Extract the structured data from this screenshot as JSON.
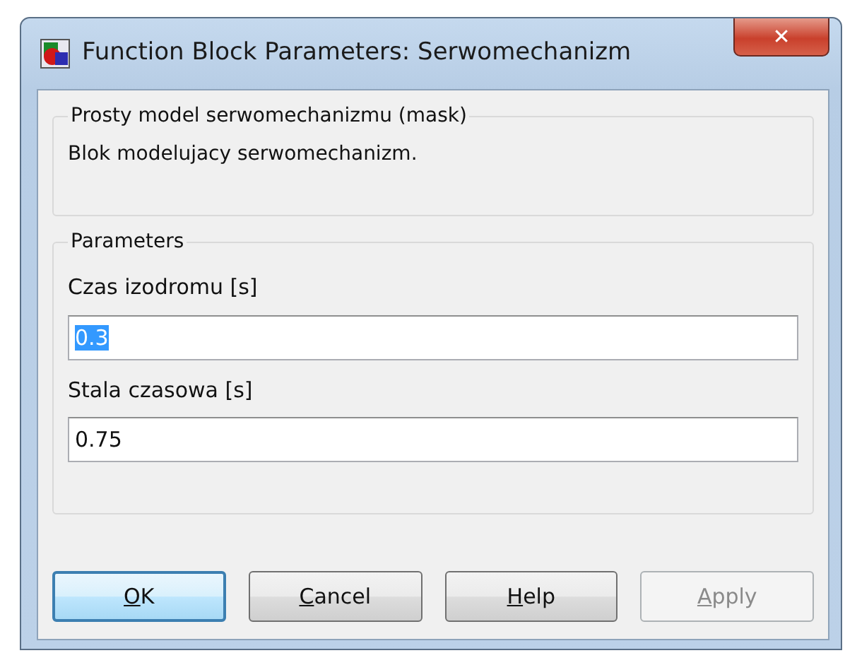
{
  "window": {
    "title": "Function Block Parameters: Serwomechanizm",
    "close": "✕"
  },
  "description_group": {
    "title": "Prosty model serwomechanizmu (mask)",
    "text": "Blok modelujacy serwomechanizm."
  },
  "parameters_group": {
    "title": "Parameters",
    "fields": [
      {
        "label": "Czas izodromu [s]",
        "value": "0.3",
        "text_selected": true
      },
      {
        "label": "Stala czasowa [s]",
        "value": "0.75",
        "text_selected": false
      }
    ]
  },
  "buttons": [
    {
      "label": "OK",
      "first_letter_underlined": true,
      "default": true,
      "disabled": false
    },
    {
      "label": "Cancel",
      "first_letter_underlined": true,
      "default": false,
      "disabled": false
    },
    {
      "label": "Help",
      "first_letter_underlined": true,
      "default": false,
      "disabled": false
    },
    {
      "label": "Apply",
      "first_letter_underlined": true,
      "default": false,
      "disabled": true
    }
  ]
}
